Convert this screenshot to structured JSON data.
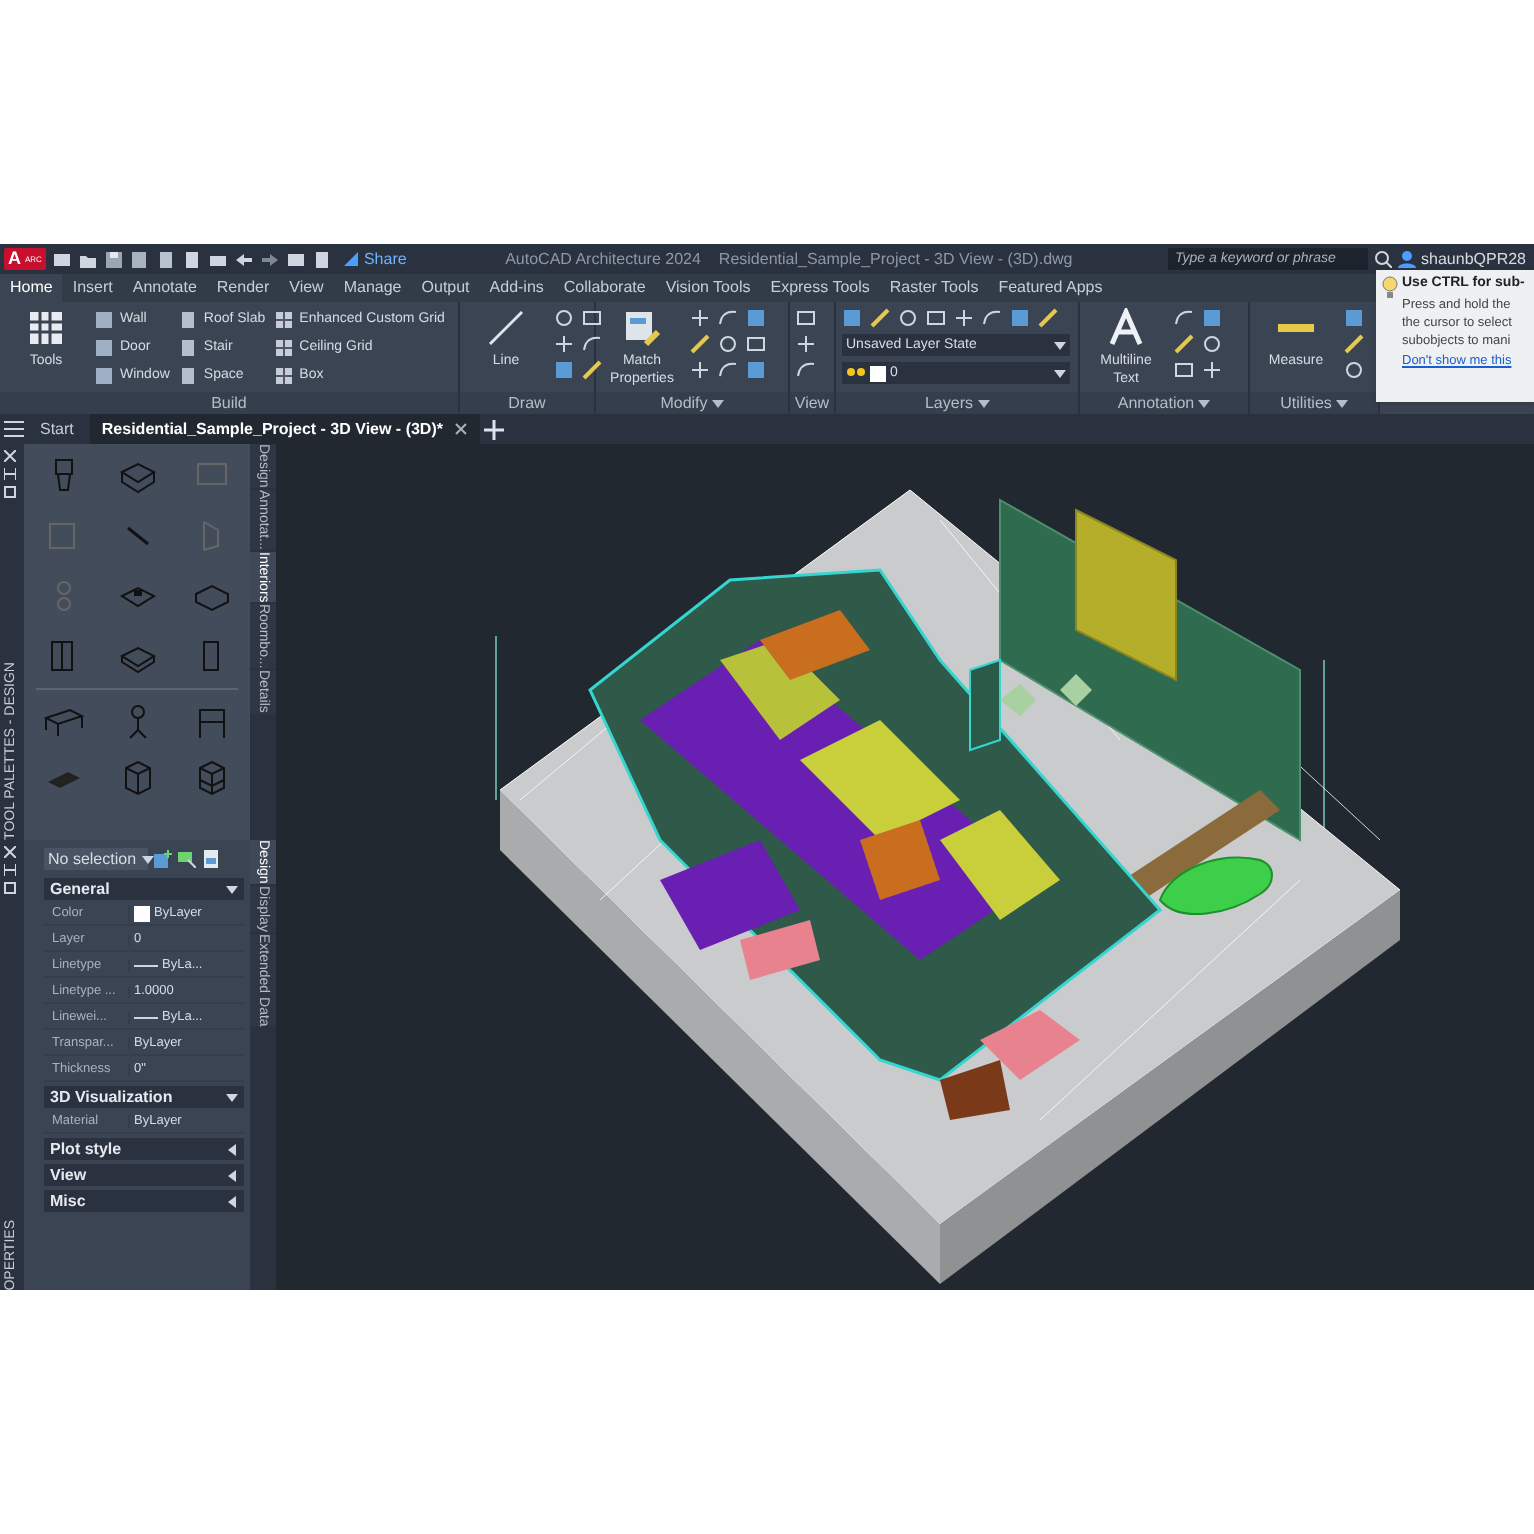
{
  "title_bar": {
    "logo": "A",
    "badge": "ARC",
    "share": "Share",
    "app_title": "AutoCAD Architecture 2024",
    "document": "Residential_Sample_Project - 3D View - (3D).dwg",
    "search": {
      "placeholder": "Type a keyword or phrase"
    },
    "user": "shaunbQPR28"
  },
  "ribbon_tabs": [
    {
      "label": "Home",
      "selected": true
    },
    {
      "label": "Insert",
      "selected": false
    },
    {
      "label": "Annotate",
      "selected": false
    },
    {
      "label": "Render",
      "selected": false
    },
    {
      "label": "View",
      "selected": false
    },
    {
      "label": "Manage",
      "selected": false
    },
    {
      "label": "Output",
      "selected": false
    },
    {
      "label": "Add-ins",
      "selected": false
    },
    {
      "label": "Collaborate",
      "selected": false
    },
    {
      "label": "Vision Tools",
      "selected": false
    },
    {
      "label": "Express Tools",
      "selected": false
    },
    {
      "label": "Raster Tools",
      "selected": false
    },
    {
      "label": "Featured Apps",
      "selected": false
    }
  ],
  "ribbon_panels": [
    {
      "kind": "build",
      "title": "Build",
      "menu": false,
      "large": "Tools",
      "columns": [
        [
          "Wall",
          "Door",
          "Window"
        ],
        [
          "Roof Slab",
          "Stair",
          "Space"
        ],
        [
          "Enhanced Custom Grid",
          "Ceiling Grid",
          "Box"
        ]
      ]
    },
    {
      "kind": "draw",
      "title": "Draw",
      "menu": false,
      "large": "Line"
    },
    {
      "kind": "modify",
      "title": "Modify",
      "menu": true,
      "large": "Match Properties"
    },
    {
      "kind": "view",
      "title": "View",
      "menu": false
    },
    {
      "kind": "layers",
      "title": "Layers",
      "menu": true,
      "fields": [
        "Unsaved Layer State",
        "0"
      ]
    },
    {
      "kind": "annotation",
      "title": "Annotation",
      "menu": true,
      "large": "Multiline Text"
    },
    {
      "kind": "utilities",
      "title": "Utilities",
      "menu": true,
      "large": "Measure"
    }
  ],
  "tooltip": {
    "title": "Use CTRL for sub-",
    "lines": [
      "Press and hold the",
      "the cursor to select",
      "subobjects to mani"
    ],
    "link": "Don't show me this"
  },
  "file_tabs": [
    {
      "label": "Start",
      "selected": false
    },
    {
      "label": "Residential_Sample_Project - 3D View - (3D)*",
      "selected": true
    }
  ],
  "tool_palette": {
    "title": "TOOL PALETTES - DESIGN",
    "tabs": [
      {
        "label": "Design",
        "selected": false
      },
      {
        "label": "Annotat...",
        "selected": false
      },
      {
        "label": "Interiors",
        "selected": true
      },
      {
        "label": "Roombo...",
        "selected": false
      },
      {
        "label": "Details",
        "selected": false
      }
    ]
  },
  "properties": {
    "title": "OPERTIES",
    "selection": "No selection",
    "tabs": [
      {
        "label": "Design",
        "selected": true
      },
      {
        "label": "Display",
        "selected": false
      },
      {
        "label": "Extended Data",
        "selected": false
      }
    ],
    "sections": [
      {
        "title": "General",
        "expanded": true,
        "rows": [
          {
            "name": "Color",
            "value": "ByLayer",
            "kind": "color"
          },
          {
            "name": "Layer",
            "value": "0",
            "kind": "text"
          },
          {
            "name": "Linetype",
            "value": "ByLa...",
            "kind": "line"
          },
          {
            "name": "Linetype ...",
            "value": "1.0000",
            "kind": "text"
          },
          {
            "name": "Linewei...",
            "value": "ByLa...",
            "kind": "line"
          },
          {
            "name": "Transpar...",
            "value": "ByLayer",
            "kind": "text"
          },
          {
            "name": "Thickness",
            "value": "0\"",
            "kind": "text"
          }
        ]
      },
      {
        "title": "3D Visualization",
        "expanded": true,
        "rows": [
          {
            "name": "Material",
            "value": "ByLayer",
            "kind": "text"
          }
        ]
      },
      {
        "title": "Plot style",
        "expanded": false
      },
      {
        "title": "View",
        "expanded": false
      },
      {
        "title": "Misc",
        "expanded": false
      }
    ]
  }
}
